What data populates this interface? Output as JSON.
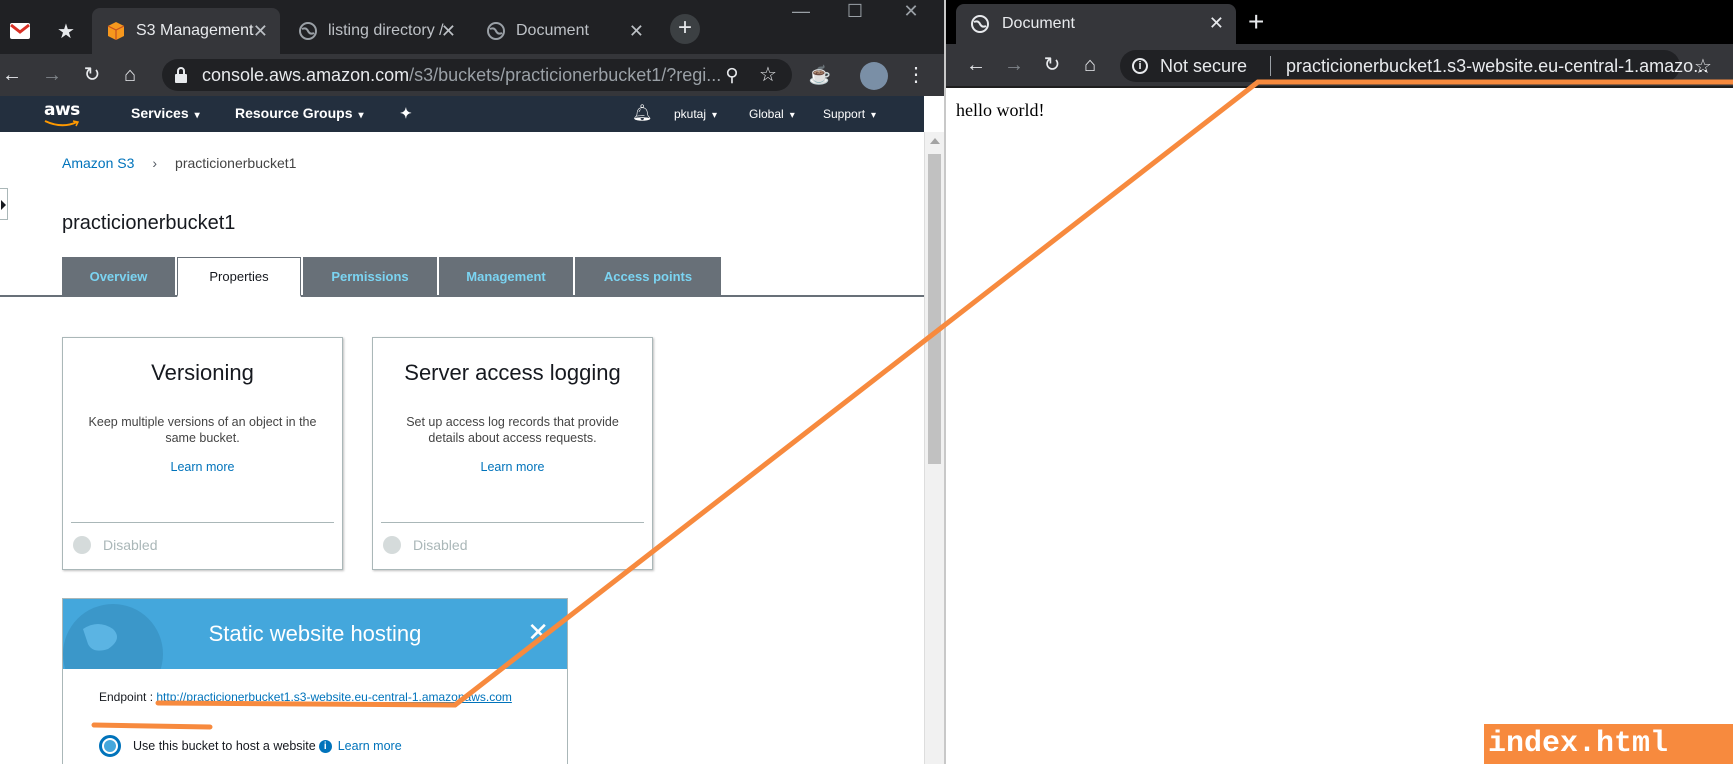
{
  "left_browser": {
    "tabs": [
      {
        "title": "S3 Management",
        "active": true
      },
      {
        "title": "listing directory /",
        "active": false
      },
      {
        "title": "Document",
        "active": false
      }
    ],
    "address": {
      "url_main": "console.aws.amazon.com",
      "url_rest": "/s3/buckets/practicionerbucket1/?regi..."
    },
    "aws_nav": {
      "logo": "aws",
      "services": "Services",
      "resource_groups": "Resource Groups",
      "user": "pkutaj",
      "region": "Global",
      "support": "Support"
    },
    "breadcrumb": {
      "root": "Amazon S3",
      "current": "practicionerbucket1"
    },
    "bucket_title": "practicionerbucket1",
    "tabs_console": [
      "Overview",
      "Properties",
      "Permissions",
      "Management",
      "Access points"
    ],
    "cards": {
      "versioning": {
        "title": "Versioning",
        "desc": "Keep multiple versions of an object in the same bucket.",
        "learn_more": "Learn more",
        "status": "Disabled"
      },
      "logging": {
        "title": "Server access logging",
        "desc": "Set up access log records that provide details about access requests.",
        "learn_more": "Learn more",
        "status": "Disabled"
      }
    },
    "static_hosting": {
      "title": "Static website hosting",
      "endpoint_label": "Endpoint : ",
      "endpoint_url": "http://practicionerbucket1.s3-website.eu-central-1.amazonaws.com",
      "radio_label": "Use this bucket to host a website",
      "learn_more": "Learn more"
    }
  },
  "right_browser": {
    "tab_title": "Document",
    "not_secure": "Not secure",
    "url": "practicionerbucket1.s3-website.eu-central-1.amazo...",
    "page_text": "hello world!"
  },
  "annotation": {
    "label": "index.html",
    "color": "#f78a3e"
  }
}
